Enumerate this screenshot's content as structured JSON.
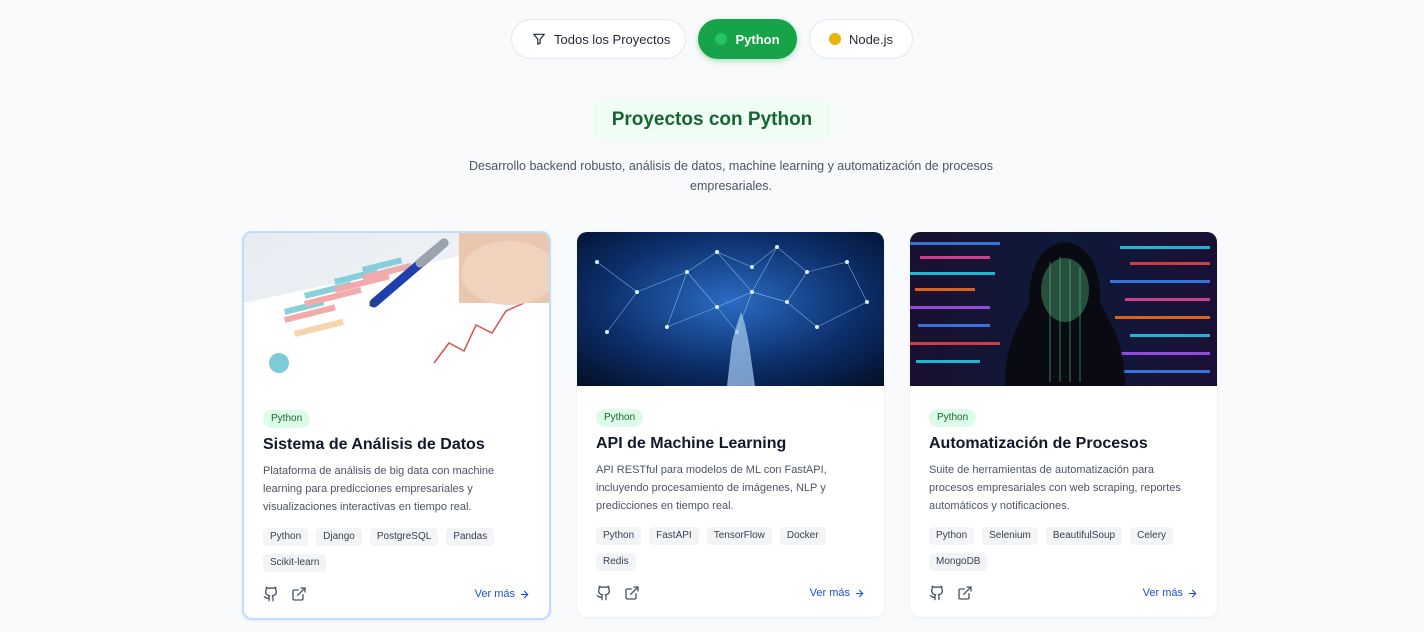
{
  "filters": {
    "all_label": "Todos los Proyectos",
    "python_label": "Python",
    "node_label": "Node.js"
  },
  "section": {
    "title": "Proyectos con Python",
    "description": "Desarrollo backend robusto, análisis de datos, machine learning y automatización de procesos empresariales."
  },
  "cards": [
    {
      "badge": "Python",
      "title": "Sistema de Análisis de Datos",
      "description": "Plataforma de análisis de big data con machine learning para predicciones empresariales y visualizaciones interactivas en tiempo real.",
      "tags": [
        "Python",
        "Django",
        "PostgreSQL",
        "Pandas",
        "Scikit-learn"
      ],
      "more": "Ver más"
    },
    {
      "badge": "Python",
      "title": "API de Machine Learning",
      "description": "API RESTful para modelos de ML con FastAPI, incluyendo procesamiento de imágenes, NLP y predicciones en tiempo real.",
      "tags": [
        "Python",
        "FastAPI",
        "TensorFlow",
        "Docker",
        "Redis"
      ],
      "more": "Ver más"
    },
    {
      "badge": "Python",
      "title": "Automatización de Procesos",
      "description": "Suite de herramientas de automatización para procesos empresariales con web scraping, reportes automáticos y notificaciones.",
      "tags": [
        "Python",
        "Selenium",
        "BeautifulSoup",
        "Celery",
        "MongoDB"
      ],
      "more": "Ver más"
    }
  ],
  "colors": {
    "accent_green": "#16a34a",
    "node_yellow": "#eab308",
    "link_blue": "#1d4ed8"
  },
  "icons": [
    "filter-icon",
    "github-icon",
    "external-link-icon",
    "arrow-right-icon"
  ]
}
